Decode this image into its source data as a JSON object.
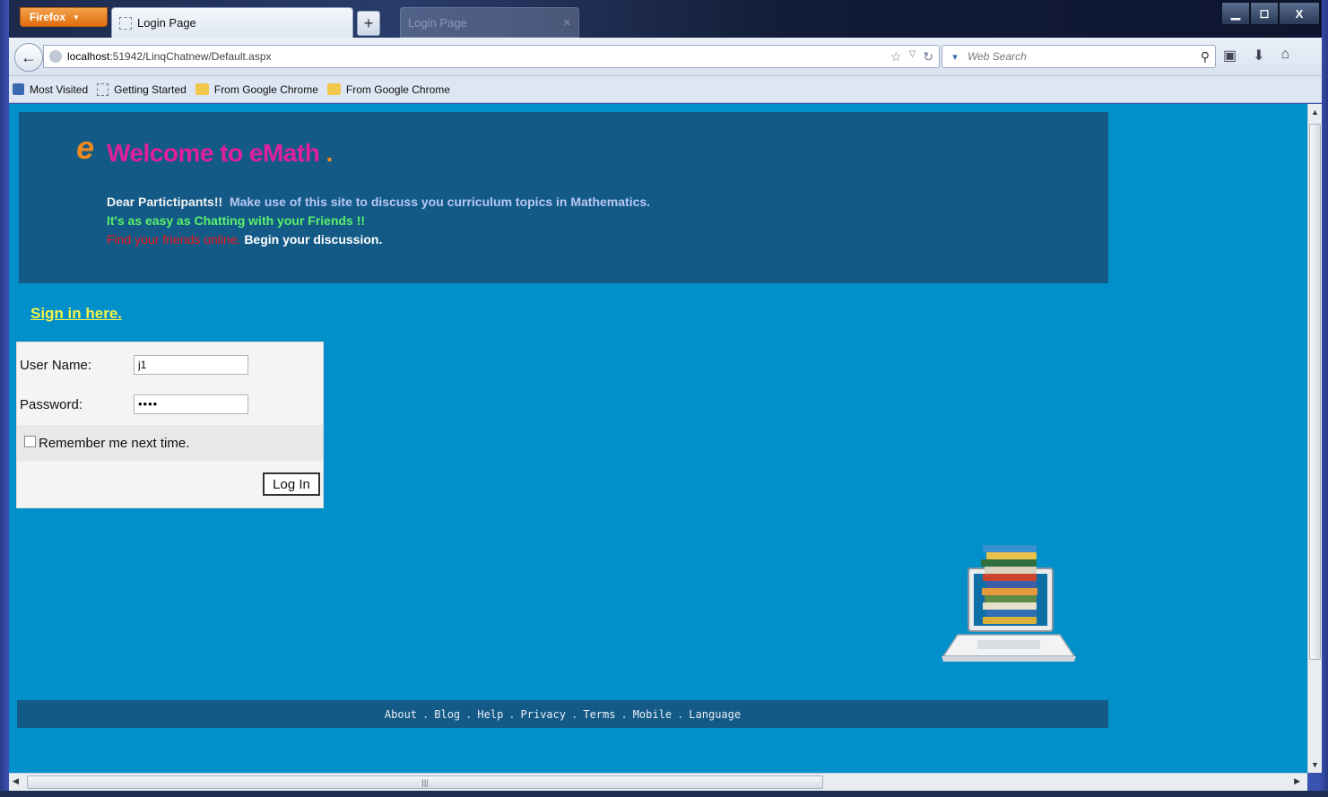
{
  "browser": {
    "menu_button": "Firefox",
    "tabs": [
      {
        "label": "Login Page",
        "active": true
      },
      {
        "label": "Login Page",
        "active": false
      }
    ],
    "new_tab": "+",
    "url_host": "localhost",
    "url_rest": ":51942/LinqChatnew/Default.aspx",
    "search_placeholder": "Web Search",
    "bookmarks": [
      "Most Visited",
      "Getting Started",
      "From Google Chrome",
      "From Google Chrome"
    ],
    "window_buttons": {
      "minimize": "▁",
      "maximize": "◻",
      "close": "X"
    }
  },
  "page": {
    "logo_letter": "e",
    "welcome_prefix": "Welcome to ",
    "welcome_brand": "eMath",
    "welcome_suffix": " .",
    "intro_line1_a": "Dear Partictipants!!",
    "intro_line1_b": "Make use of this site to discuss you curriculum topics in Mathematics.",
    "intro_line2": "It's as easy as Chatting with your Friends !!",
    "intro_line3_a": "Find your friends online.",
    "intro_line3_b": "Begin your discussion.",
    "sign_in_link": "Sign in here.",
    "login": {
      "username_label": "User Name:",
      "username_value": "j1",
      "password_label": "Password:",
      "password_value": "••••",
      "remember_label": "Remember me next time.",
      "remember_checked": false,
      "login_button": "Log In"
    },
    "footer_links": [
      "About",
      "Blog",
      "Help",
      "Privacy",
      "Terms",
      "Mobile",
      "Language"
    ],
    "footer_separator": "."
  },
  "colors": {
    "page_bg": "#0190c9",
    "banner_bg": "#135a87",
    "welcome": "#e0209a",
    "logo": "#f08a1e",
    "sign_in": "#f6f24a",
    "tagline_green": "#5cf06a",
    "tagline_red": "#f21a1a"
  },
  "icons": [
    "back-arrow-icon",
    "globe-icon",
    "star-icon",
    "reload-icon",
    "search-icon",
    "bookmarks-icon",
    "download-icon",
    "home-icon",
    "laptop-books-icon"
  ]
}
